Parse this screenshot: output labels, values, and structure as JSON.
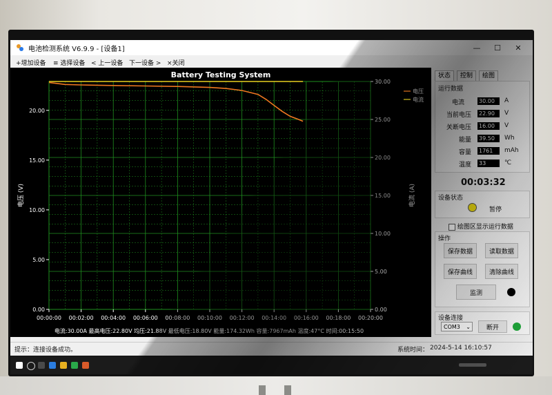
{
  "window": {
    "title": "电池检测系统 V6.9.9 - [设备1]",
    "controls": {
      "minimize": "—",
      "maximize": "☐",
      "close": "✕"
    }
  },
  "menu": {
    "items": [
      "+增加设备",
      "≡ 选择设备",
      "< 上一设备",
      "下一设备 >",
      "×关闭"
    ]
  },
  "chart_data": {
    "type": "line",
    "title": "Battery Testing System",
    "ylabel_left": "电压 (V)",
    "ylabel_right": "电流 (A)",
    "xlim": [
      "00:00:00",
      "00:20:00"
    ],
    "ylim_left": [
      0,
      22.9
    ],
    "ylim_right": [
      0,
      30
    ],
    "x_ticks": [
      "00:00:00",
      "00:02:00",
      "00:04:00",
      "00:06:00",
      "00:08:00",
      "00:10:00",
      "00:12:00",
      "00:14:00",
      "00:16:00",
      "00:18:00",
      "00:20:00"
    ],
    "y_left_ticks": [
      "20.00",
      "15.00",
      "10.00",
      "5.00",
      "0.00"
    ],
    "y_left_tick_values": [
      20,
      15,
      10,
      5,
      0
    ],
    "y_right_ticks": [
      "30.00",
      "25.00",
      "20.00",
      "15.00",
      "10.00",
      "5.00",
      "0.00"
    ],
    "y_right_tick_values": [
      30,
      25,
      20,
      15,
      10,
      5,
      0
    ],
    "grid": true,
    "legend_position": "top-right",
    "background": "#000000",
    "grid_color": "#1f8f1f",
    "series": [
      {
        "name": "电压",
        "color": "#f07820",
        "axis": "left",
        "x_min": [
          0,
          1,
          2,
          4,
          6,
          8,
          10,
          11,
          12,
          13,
          13.5,
          14,
          14.5,
          15,
          15.5,
          15.8
        ],
        "y": [
          22.8,
          22.6,
          22.55,
          22.5,
          22.45,
          22.4,
          22.3,
          22.2,
          22.0,
          21.6,
          21.1,
          20.5,
          19.9,
          19.4,
          19.1,
          18.9
        ]
      },
      {
        "name": "电流",
        "color": "#e8d020",
        "axis": "right",
        "x_min": [
          0,
          2,
          4,
          6,
          8,
          10,
          12,
          14,
          15.8
        ],
        "y": [
          30,
          30,
          30,
          30,
          30,
          30,
          30,
          30,
          30
        ]
      }
    ],
    "summary_text": "电流:30.00A 最高电压:22.80V 均压:21.88V 最低电压:18.80V 能量:174.32Wh 容量:7967mAh 温度:47°C 时间:00:15:50"
  },
  "right_panel": {
    "tabs": [
      "状态",
      "控制",
      "绘图"
    ],
    "run_data_label": "运行数据",
    "params": [
      {
        "label": "电流",
        "value": "30.00",
        "unit": "A"
      },
      {
        "label": "当前电压",
        "value": "22.90",
        "unit": "V"
      },
      {
        "label": "关断电压",
        "value": "16.00",
        "unit": "V"
      },
      {
        "label": "能量",
        "value": "39.50",
        "unit": "Wh"
      },
      {
        "label": "容量",
        "value": "1761",
        "unit": "mAh"
      },
      {
        "label": "温度",
        "value": "33",
        "unit": "℃"
      }
    ],
    "timer": "00:03:32",
    "device_status_label": "设备状态",
    "device_status": "暂停",
    "status_color": "#f2e010",
    "show_run_data_label": "绘图区显示运行数据",
    "operations_label": "操作",
    "buttons": [
      "保存数据",
      "读取数据",
      "保存曲线",
      "清除曲线"
    ],
    "monitor_button": "监测",
    "connection_label": "设备连接",
    "port": "COM3",
    "disconnect_button": "断开",
    "connection_color": "#1fa83a"
  },
  "statusbar": {
    "hint": "提示：连接设备成功。",
    "system_time_label": "系统时间：",
    "system_time": "2024-5-14 16:10:57"
  }
}
